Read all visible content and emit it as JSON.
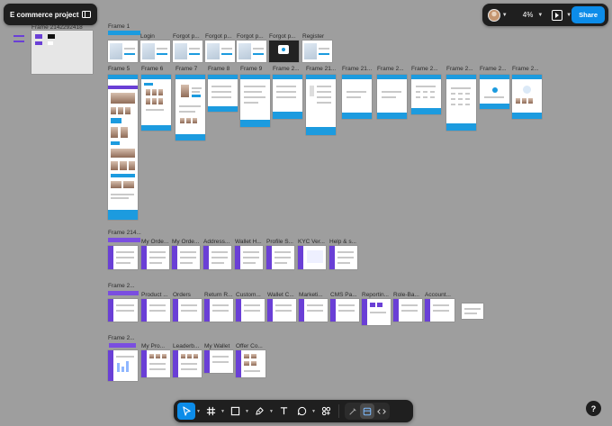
{
  "project": {
    "title": "E commerce project"
  },
  "topbar": {
    "zoom": "4%",
    "share_label": "Share"
  },
  "sections": {
    "top_left_frame_label": "Frame 2142292418",
    "row1_title": "Frame 1",
    "row1": [
      "Login",
      "Forgot p...",
      "Forgot p...",
      "Forgot p...",
      "Forgot p...",
      "Register"
    ],
    "row2": [
      "Frame 5",
      "Frame 6",
      "Frame 7",
      "Frame 8",
      "Frame 9",
      "Frame 2...",
      "Frame 21...",
      "Frame 21...",
      "Frame 2...",
      "Frame 2...",
      "Frame 2...",
      "Frame 2...",
      "Frame 2..."
    ],
    "row3": [
      "Frame 214...",
      "My Orde...",
      "My Orde...",
      "Address...",
      "Wallet H...",
      "Profile S...",
      "KYC Ver...",
      "Help & s..."
    ],
    "row4": [
      "Frame 2...",
      "Product ...",
      "Orders",
      "Return R...",
      "Custom...",
      "Wallet C...",
      "Marketi...",
      "CMS Pa...",
      "Reportin...",
      "Role-Ba...",
      "Account..."
    ],
    "row5": [
      "Frame 2...",
      "My Pro...",
      "Leaderb...",
      "My Wallet",
      "Offer Co..."
    ]
  },
  "icons": {
    "sidebar": "sidebar-toggle-icon",
    "play": "present-play-icon",
    "move": "move-cursor-icon",
    "frame": "frame-hash-icon",
    "rect": "rectangle-icon",
    "pen": "pen-icon",
    "text": "text-icon",
    "comment": "comment-icon",
    "actions": "actions-icon",
    "draw": "draw-mode-icon",
    "design": "design-mode-icon",
    "dev": "dev-mode-icon",
    "help": "?"
  },
  "colors": {
    "canvas": "#9e9e9e",
    "accent": "#0c8ce9",
    "frame_blue": "#1c9bdf",
    "admin_purple": "#6a3fd6"
  }
}
